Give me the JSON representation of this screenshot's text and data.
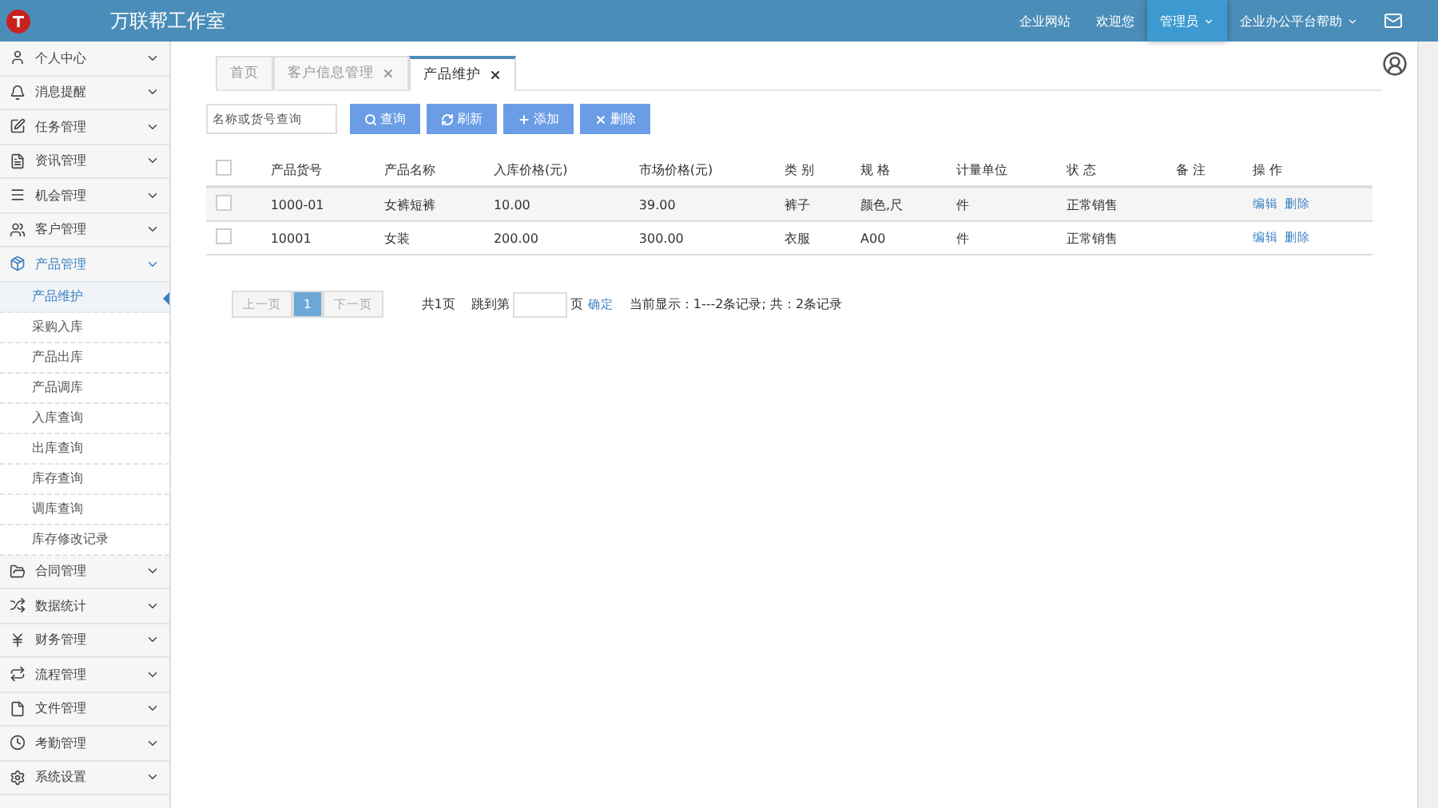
{
  "header": {
    "title": "万联帮工作室",
    "nav": [
      {
        "label": "企业网站",
        "selected": false,
        "dropdown": false
      },
      {
        "label": "欢迎您",
        "selected": false,
        "dropdown": false
      },
      {
        "label": "管理员",
        "selected": true,
        "dropdown": true
      },
      {
        "label": "企业办公平台帮助",
        "selected": false,
        "dropdown": true
      }
    ]
  },
  "sidebar": {
    "items": [
      {
        "label": "个人中心",
        "expanded": false
      },
      {
        "label": "消息提醒",
        "expanded": false
      },
      {
        "label": "任务管理",
        "expanded": false
      },
      {
        "label": "资讯管理",
        "expanded": false
      },
      {
        "label": "机会管理",
        "expanded": false
      },
      {
        "label": "客户管理",
        "expanded": false
      },
      {
        "label": "产品管理",
        "expanded": true,
        "children": [
          {
            "label": "产品维护",
            "selected": true
          },
          {
            "label": "采购入库",
            "selected": false
          },
          {
            "label": "产品出库",
            "selected": false
          },
          {
            "label": "产品调库",
            "selected": false
          },
          {
            "label": "入库查询",
            "selected": false
          },
          {
            "label": "出库查询",
            "selected": false
          },
          {
            "label": "库存查询",
            "selected": false
          },
          {
            "label": "调库查询",
            "selected": false
          },
          {
            "label": "库存修改记录",
            "selected": false
          }
        ]
      },
      {
        "label": "合同管理",
        "expanded": false
      },
      {
        "label": "数据统计",
        "expanded": false
      },
      {
        "label": "财务管理",
        "expanded": false
      },
      {
        "label": "流程管理",
        "expanded": false
      },
      {
        "label": "文件管理",
        "expanded": false
      },
      {
        "label": "考勤管理",
        "expanded": false
      },
      {
        "label": "系统设置",
        "expanded": false
      }
    ]
  },
  "tabs": [
    {
      "label": "首页",
      "selected": false,
      "closable": false
    },
    {
      "label": "客户信息管理",
      "selected": false,
      "closable": true
    },
    {
      "label": "产品维护",
      "selected": true,
      "closable": true
    }
  ],
  "toolbar": {
    "search": {
      "placeholder": "名称或货号查询"
    },
    "buttons": [
      "查询",
      "刷新",
      "添加",
      "删除"
    ]
  },
  "table": {
    "select_all_checked": false,
    "columns": [
      "产品货号",
      "产品名称",
      "入库价格(元)",
      "市场价格(元)",
      "类 别",
      "规 格",
      "计量单位",
      "状 态",
      "备 注",
      "操 作"
    ],
    "rows": [
      {
        "checked": false,
        "cells": [
          "1000-01",
          "女裤短裤",
          "10.00",
          "39.00",
          "裤子",
          "颜色,尺",
          "件",
          "正常销售",
          ""
        ],
        "actions": [
          "编辑",
          "删除"
        ]
      },
      {
        "checked": false,
        "cells": [
          "10001",
          "女装",
          "200.00",
          "300.00",
          "衣服",
          "A00",
          "件",
          "正常销售",
          ""
        ],
        "actions": [
          "编辑",
          "删除"
        ]
      }
    ]
  },
  "pagination": {
    "prev": "上一页",
    "pages": [
      {
        "label": "1",
        "selected": true
      }
    ],
    "next": "下一页",
    "total_pages": "共1页",
    "goto_before": "跳到第",
    "goto_after": "页",
    "confirm": "确定",
    "summary": "当前显示：1---2条记录;  共：2条记录"
  }
}
